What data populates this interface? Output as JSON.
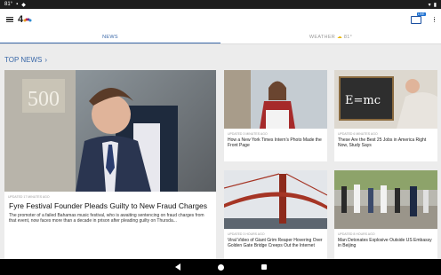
{
  "status_bar": {
    "temperature": "81°",
    "battery_icon": "battery-icon",
    "signal_icon": "signal-icon"
  },
  "app": {
    "logo_text": "4",
    "live_badge": "LIVE"
  },
  "tabs": [
    {
      "label": "NEWS"
    },
    {
      "label": "WEATHER",
      "temp": "81°"
    }
  ],
  "section": {
    "title": "TOP NEWS",
    "chevron": "›"
  },
  "main_story": {
    "updated": "UPDATED 17 MINUTES AGO",
    "headline": "Fyre Festival Founder Pleads Guilty to New Fraud Charges",
    "summary": "The promoter of a failed Bahamas music festival, who is awaiting sentencing on fraud charges from that event, now faces more than a decade in prison after pleading guilty on Thursda..."
  },
  "stories": [
    {
      "updated": "UPDATED 3 MINUTES AGO",
      "headline": "How a New York Times Intern's Photo Made the Front Page"
    },
    {
      "updated": "UPDATED 6 MINUTES AGO",
      "headline": "These Are the Best 25 Jobs in America Right Now, Study Says"
    },
    {
      "updated": "UPDATED 3 HOURS AGO",
      "headline": "Viral Video of Giant Grim Reaper Hovering Over Golden Gate Bridge Creeps Out the Internet"
    },
    {
      "updated": "UPDATED 8 HOURS AGO",
      "headline": "Man Detonates Explosive Outside US Embassy in Beijing"
    }
  ]
}
